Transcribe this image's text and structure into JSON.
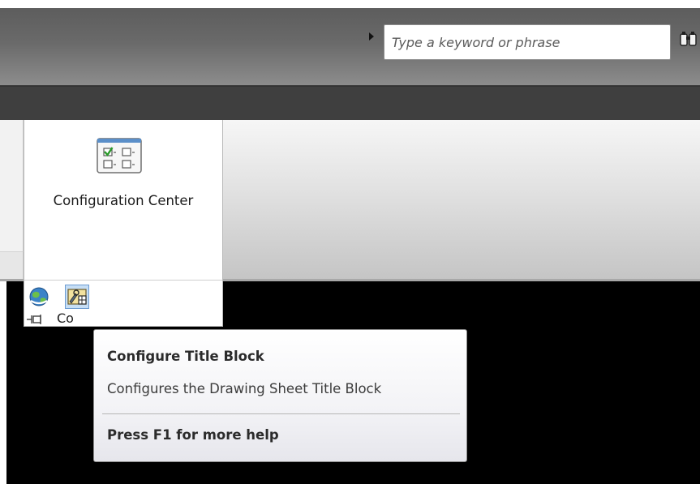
{
  "search": {
    "placeholder": "Type a keyword or phrase",
    "value": ""
  },
  "ribbon_panel": {
    "button_label": "Configuration Center",
    "footer_label_partial": "Co"
  },
  "tooltip": {
    "title": "Configure Title Block",
    "description": "Configures the Drawing Sheet Title Block",
    "help": "Press F1 for more help"
  },
  "icons": {
    "search_arrow": "play-arrow-icon",
    "binoculars": "binoculars-icon",
    "configuration_center": "checklist-grid-icon",
    "small_button_1": "globe-icon",
    "small_button_2": "title-block-config-icon",
    "pin": "pin-icon"
  },
  "colors": {
    "titlebar": "#6a6a6a",
    "tabstrip": "#3f3f3f",
    "selected_button_fill": "#c6def5",
    "selected_button_border": "#6c9bd1",
    "drawing_background": "#000000"
  }
}
